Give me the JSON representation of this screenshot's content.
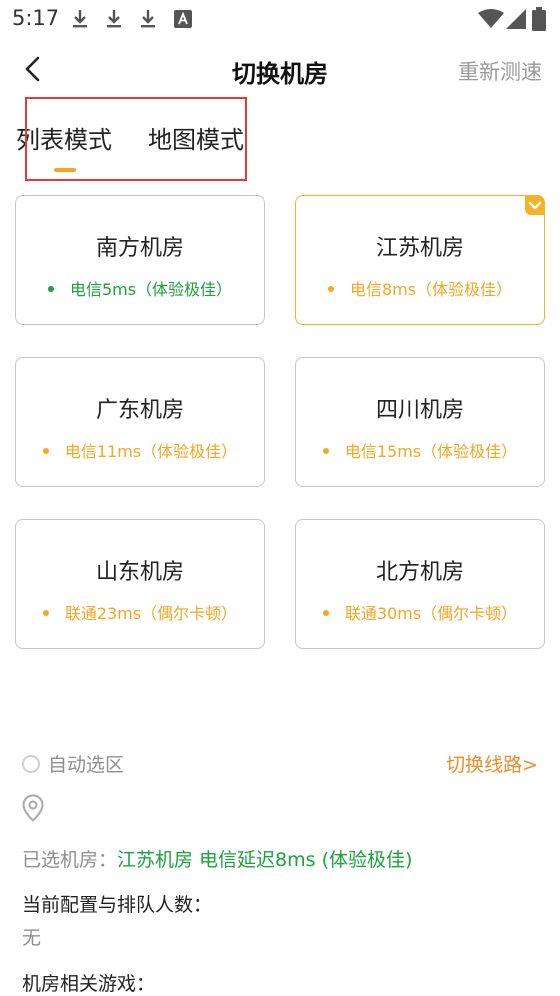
{
  "status_bar": {
    "time": "5:17"
  },
  "header": {
    "title": "切换机房",
    "retest_label": "重新测速"
  },
  "tabs": [
    {
      "label": "列表模式"
    },
    {
      "label": "地图模式"
    }
  ],
  "rooms": [
    {
      "name": "南方机房",
      "latency": "电信5ms（体验极佳）"
    },
    {
      "name": "江苏机房",
      "latency": "电信8ms（体验极佳）"
    },
    {
      "name": "广东机房",
      "latency": "电信11ms（体验极佳）"
    },
    {
      "name": "四川机房",
      "latency": "电信15ms（体验极佳）"
    },
    {
      "name": "山东机房",
      "latency": "联通23ms（偶尔卡顿）"
    },
    {
      "name": "北方机房",
      "latency": "联通30ms（偶尔卡顿）"
    }
  ],
  "auto_select": {
    "label": "自动选区"
  },
  "switch_line_label": "切换线路>",
  "selected": {
    "prefix": "已选机房：",
    "value": "江苏机房 电信延迟8ms (体验极佳)"
  },
  "config": {
    "label": "当前配置与排队人数：",
    "value": "无"
  },
  "games": {
    "label": "机房相关游戏："
  },
  "colors": {
    "accent": "#f5a623",
    "good": "#1aa33b",
    "link": "#f08a2a",
    "highlight_border": "#e53935"
  }
}
